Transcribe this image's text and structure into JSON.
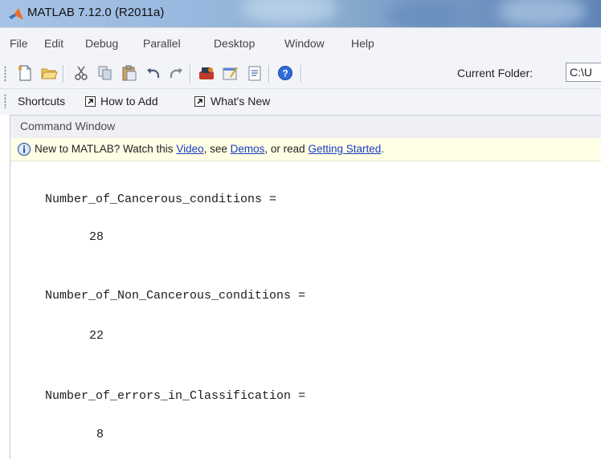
{
  "window": {
    "title": "MATLAB  7.12.0 (R2011a)"
  },
  "menu": {
    "items": [
      "File",
      "Edit",
      "Debug",
      "Parallel",
      "Desktop",
      "Window",
      "Help"
    ]
  },
  "toolbar": {
    "icons": [
      "new-file-icon",
      "open-folder-icon",
      "cut-icon",
      "copy-icon",
      "paste-icon",
      "undo-icon",
      "redo-icon",
      "simulink-icon",
      "guide-icon",
      "profiler-icon",
      "help-icon"
    ],
    "current_folder_label": "Current Folder:",
    "current_folder_value": "C:\\U"
  },
  "shortcuts": {
    "shortcuts_label": "Shortcuts",
    "how_to_add_label": "How to Add",
    "whats_new_label": "What's New"
  },
  "command_window": {
    "title": "Command Window",
    "info": {
      "prefix": "New to MATLAB? Watch this ",
      "video_link": "Video",
      "mid1": ", see ",
      "demos_link": "Demos",
      "mid2": ", or read ",
      "getting_started_link": "Getting Started",
      "suffix": "."
    },
    "output": [
      {
        "name": "Number_of_Cancerous_conditions",
        "equals": " =",
        "value": "28"
      },
      {
        "name": "Number_of_Non_Cancerous_conditions",
        "equals": " =",
        "value": "22"
      },
      {
        "name": "Number_of_errors_in_Classification",
        "equals": " =",
        "value": "8"
      }
    ]
  },
  "colors": {
    "title_bar_left": "#a7c3e6",
    "title_bar_right": "#5d84b6",
    "chrome_background": "#f3f4f8",
    "info_bar_background": "#ffffe6",
    "link_color": "#1a3cc4"
  }
}
